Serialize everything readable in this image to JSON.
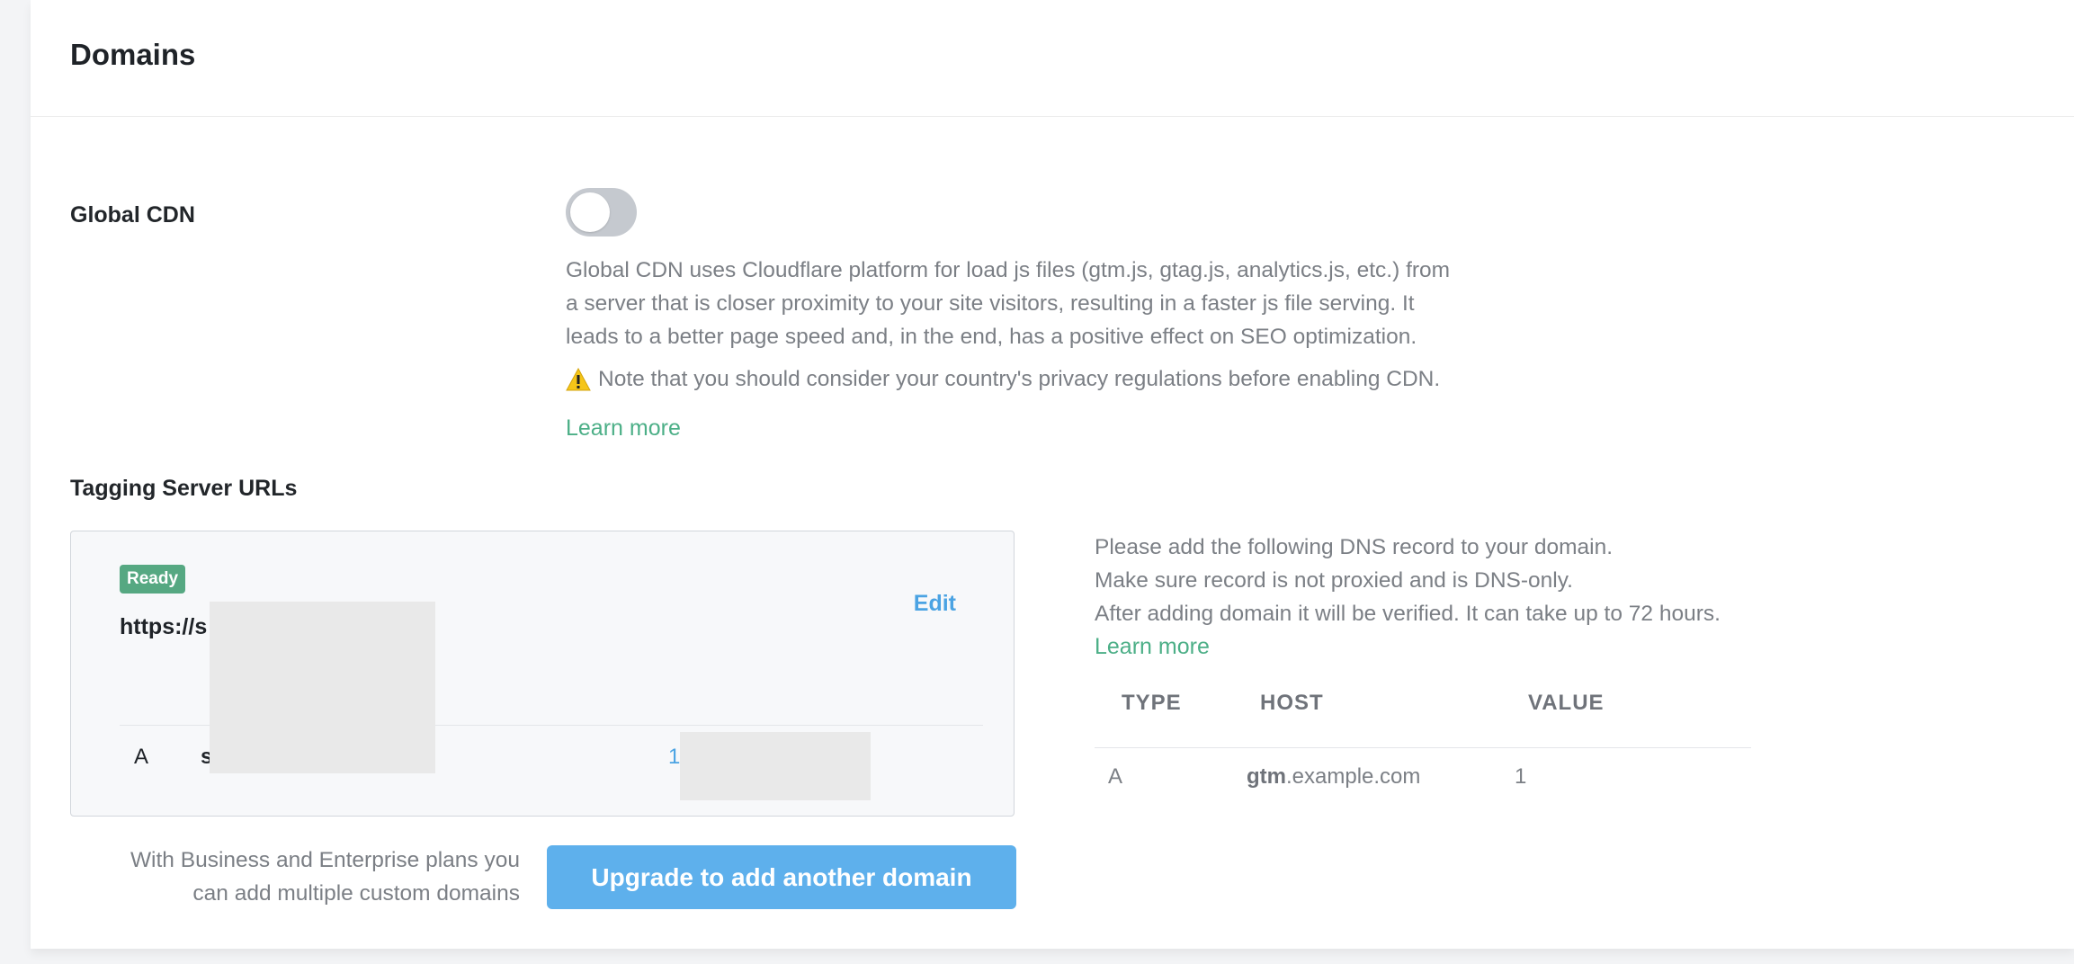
{
  "page": {
    "title": "Domains"
  },
  "global_cdn": {
    "label": "Global CDN",
    "enabled": false,
    "description_lines": [
      "Global CDN uses Cloudflare platform for load js files (gtm.js, gtag.js, analytics.js, etc.) from",
      "a server that is closer proximity to your site visitors, resulting in a faster js file serving. It",
      "leads to a better page speed and, in the end, has a positive effect on SEO optimization."
    ],
    "note": "Note that you should consider your country's privacy regulations before enabling CDN.",
    "learn_more": "Learn more"
  },
  "tagging_server": {
    "label": "Tagging Server URLs",
    "card": {
      "status_badge": "Ready",
      "url": "https://s",
      "edit": "Edit",
      "record": {
        "type": "A",
        "host": "s",
        "value": "1"
      }
    },
    "dns_info_lines": [
      "Please add the following DNS record to your domain.",
      "Make sure record is not proxied and is DNS-only.",
      "After adding domain it will be verified. It can take up to 72 hours."
    ],
    "learn_more": "Learn more",
    "table": {
      "headers": [
        "TYPE",
        "HOST",
        "VALUE"
      ],
      "row": {
        "type": "A",
        "host_bold": "gtm",
        "host_rest": ".example.com",
        "value": "1"
      }
    },
    "plan_note_lines": [
      "With Business and Enterprise plans you",
      "can add multiple custom domains"
    ],
    "upgrade_button": "Upgrade to add another domain"
  },
  "colors": {
    "accent_green": "#4caf87",
    "badge_green": "#56a882",
    "link_blue": "#4ba3e3",
    "button_blue": "#5eb0ec",
    "warning_yellow": "#f5c518"
  }
}
